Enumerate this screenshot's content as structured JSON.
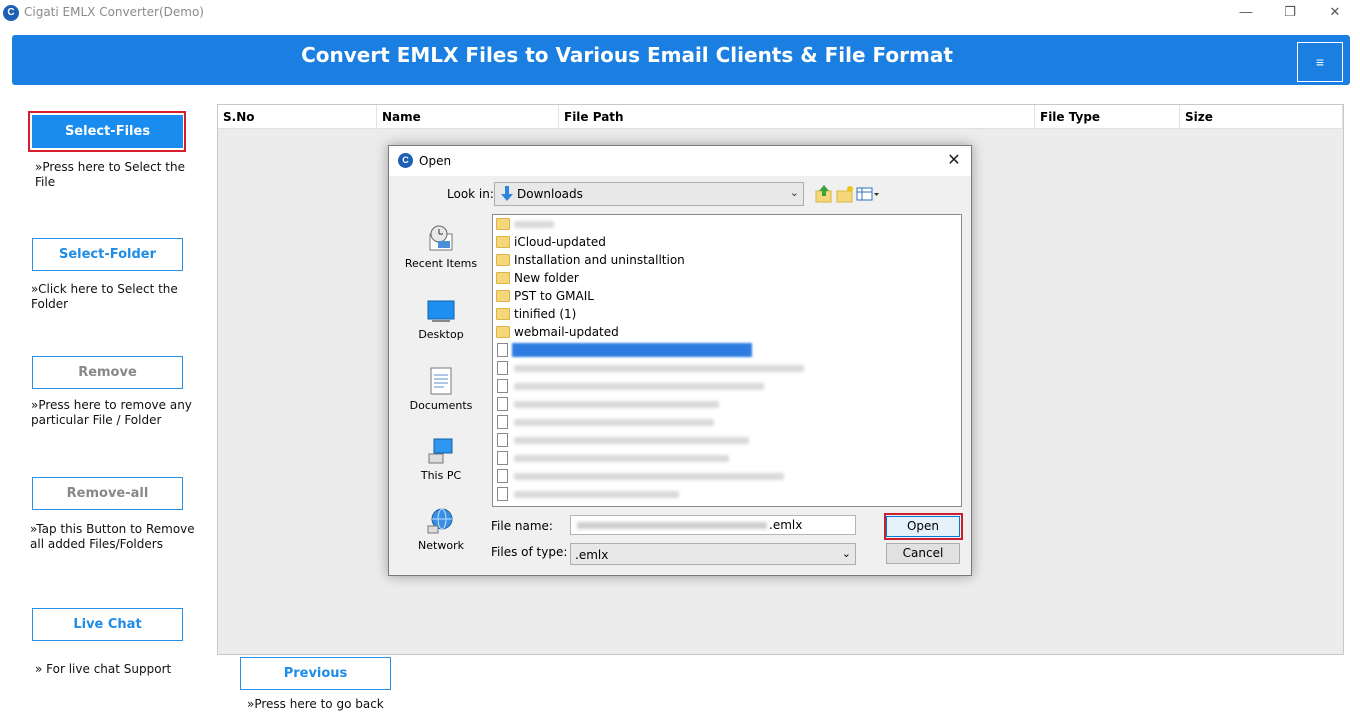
{
  "window": {
    "title": "Cigati EMLX Converter(Demo)",
    "icon_letter": "C",
    "minimize": "—",
    "restore": "❐",
    "close": "✕"
  },
  "banner": {
    "title": "Convert EMLX Files to Various Email Clients & File Format",
    "menu_icon": "≡"
  },
  "sidebar": {
    "select_files": {
      "label": "Select-Files",
      "help": "»Press here to Select the File"
    },
    "select_folder": {
      "label": "Select-Folder",
      "help": "»Click here to Select the Folder"
    },
    "remove": {
      "label": "Remove",
      "help": "»Press here to remove any particular File / Folder"
    },
    "remove_all": {
      "label": "Remove-all",
      "help": "»Tap this Button to Remove all added Files/Folders"
    },
    "live_chat": {
      "label": "Live Chat",
      "help": "» For live chat Support"
    }
  },
  "table": {
    "columns": [
      "S.No",
      "Name",
      "File Path",
      "File Type",
      "Size"
    ]
  },
  "previous": {
    "label": "Previous",
    "help": "»Press here to go back"
  },
  "dialog": {
    "title": "Open",
    "close": "✕",
    "look_in_label": "Look in:",
    "look_in_value": "Downloads",
    "places": [
      "Recent Items",
      "Desktop",
      "Documents",
      "This PC",
      "Network"
    ],
    "folders": [
      "iCloud-updated",
      "Installation and uninstalltion",
      "New folder",
      "PST to GMAIL",
      "tinified (1)",
      "webmail-updated"
    ],
    "file_name_label": "File name:",
    "file_name_value": ".emlx",
    "file_type_label": "Files of type:",
    "file_type_value": ".emlx",
    "open_label": "Open",
    "cancel_label": "Cancel"
  },
  "colors": {
    "brand_blue": "#1a7fe0",
    "highlight_red": "#d81e2c"
  }
}
